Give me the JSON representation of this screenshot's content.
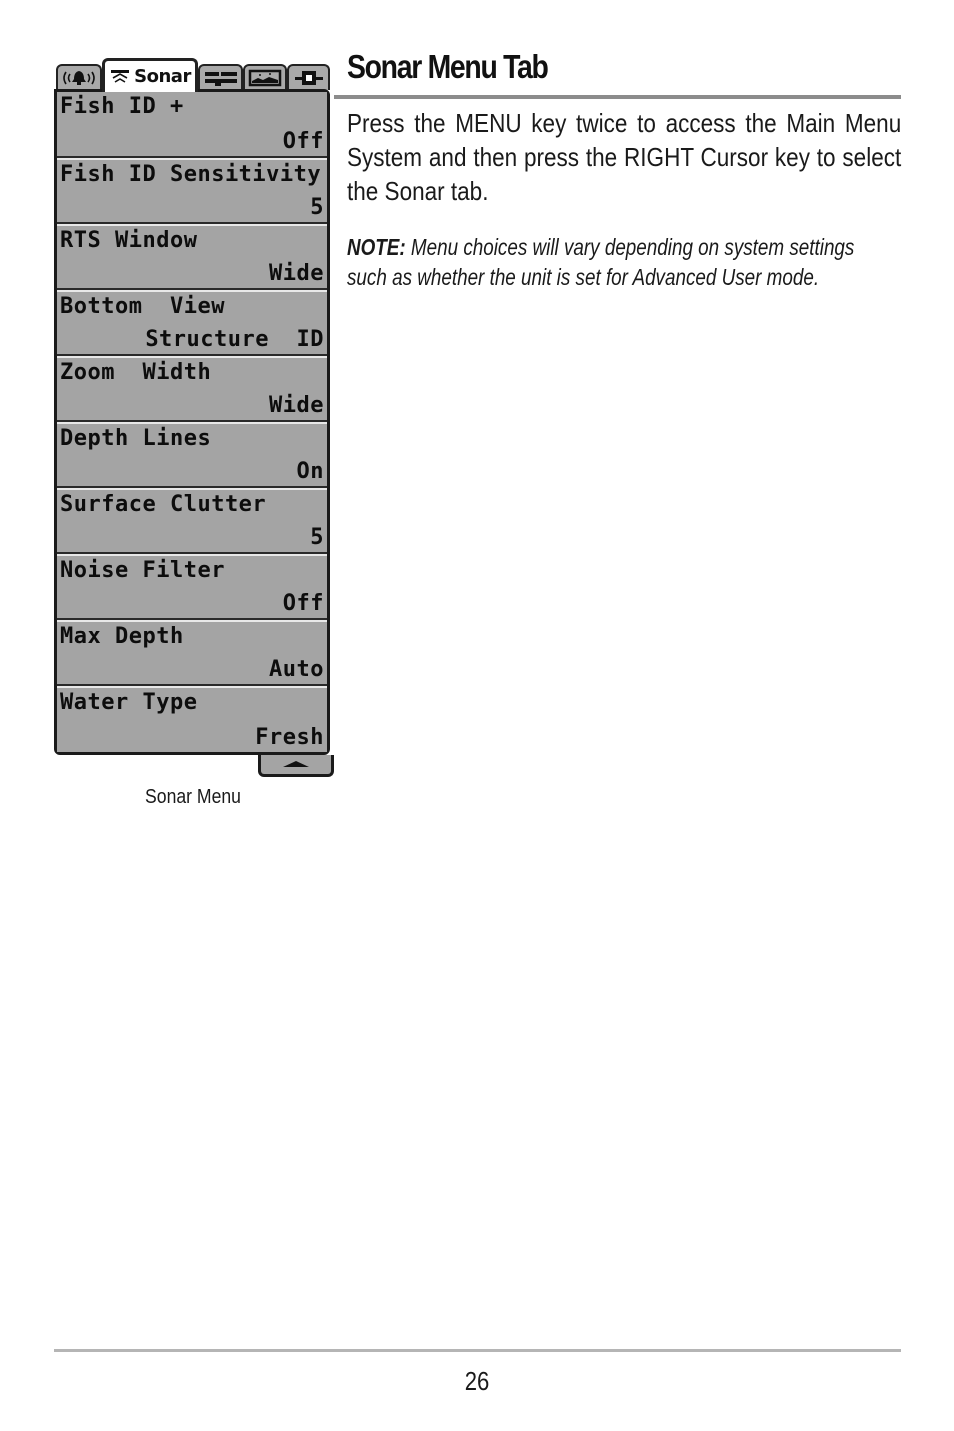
{
  "menu": {
    "tabs": [
      {
        "name": "alarms",
        "icon": "alarm-bell-icon",
        "label": "",
        "active": false
      },
      {
        "name": "sonar",
        "icon": "sonar-icon",
        "label": "Sonar",
        "active": true
      },
      {
        "name": "setup",
        "icon": "setup-wrench-icon",
        "label": "",
        "active": false
      },
      {
        "name": "views",
        "icon": "views-icon",
        "label": "",
        "active": false
      },
      {
        "name": "accessories",
        "icon": "accessory-icon",
        "label": "",
        "active": false
      }
    ],
    "items": [
      {
        "label": "Fish ID +",
        "value": "Off"
      },
      {
        "label": "Fish ID Sensitivity",
        "value": "5"
      },
      {
        "label": "RTS Window",
        "value": "Wide"
      },
      {
        "label": "Bottom  View",
        "value": "Structure  ID"
      },
      {
        "label": "Zoom  Width",
        "value": "Wide"
      },
      {
        "label": "Depth Lines",
        "value": "On"
      },
      {
        "label": "Surface Clutter",
        "value": "5"
      },
      {
        "label": "Noise Filter",
        "value": "Off"
      },
      {
        "label": "Max Depth",
        "value": "Auto"
      },
      {
        "label": "Water Type",
        "value": "Fresh"
      }
    ],
    "scroll_icon": "scroll-up-arrow-icon",
    "caption": "Sonar Menu"
  },
  "section": {
    "title": "Sonar Menu Tab",
    "body": "Press the MENU key twice to access the Main Menu System and then press the RIGHT Cursor key to select the Sonar tab.",
    "note_label": "NOTE:",
    "note_text": " Menu choices will vary depending on system settings such as whether the unit is set for Advanced User mode."
  },
  "footer": {
    "page_number": "26"
  }
}
